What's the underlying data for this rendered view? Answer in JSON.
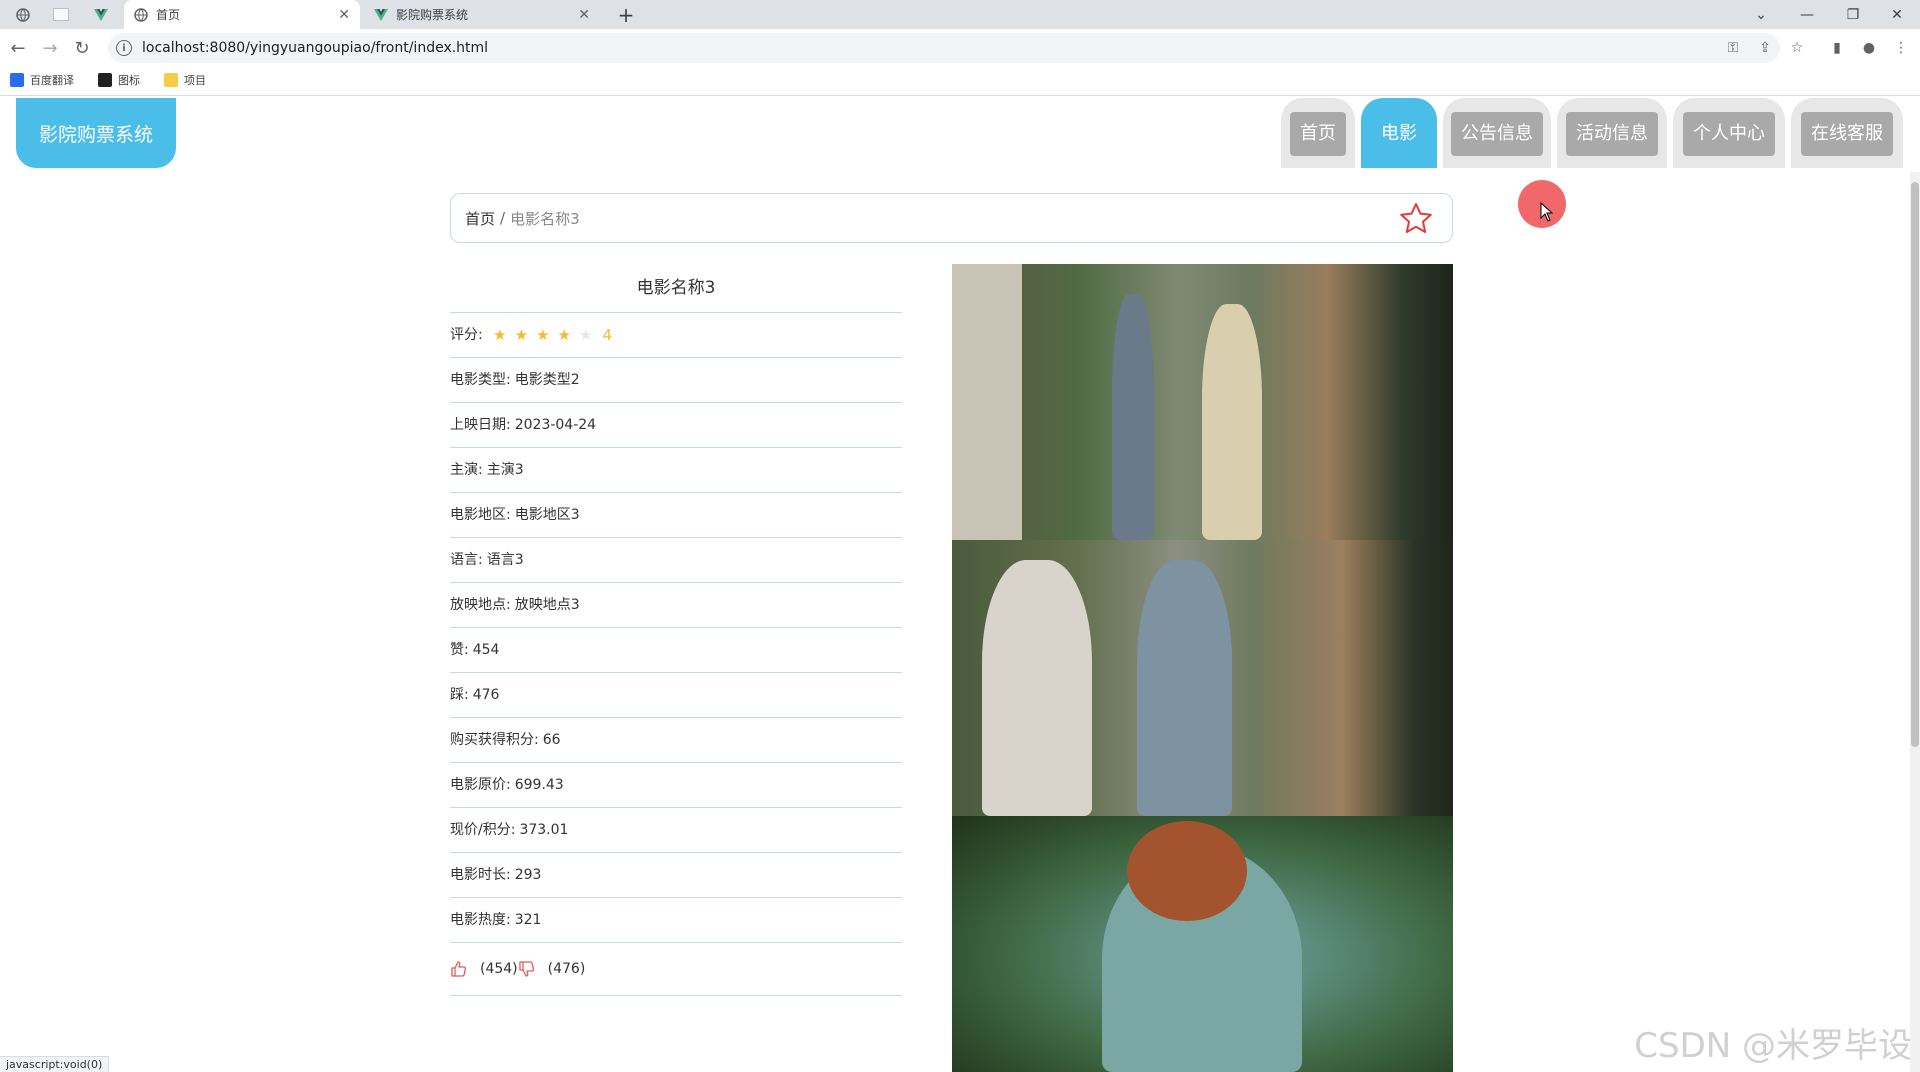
{
  "browser": {
    "tabs": [
      {
        "title": "首页",
        "active": true
      },
      {
        "title": "影院购票系统",
        "active": false
      }
    ],
    "url": "localhost:8080/yingyuangoupiao/front/index.html",
    "bookmarks": [
      "百度翻译",
      "图标",
      "项目"
    ],
    "status_text": "javascript:void(0)"
  },
  "header": {
    "logo": "影院购票系统",
    "nav": [
      {
        "label": "首页",
        "active": false
      },
      {
        "label": "电影",
        "active": true
      },
      {
        "label": "公告信息",
        "active": false
      },
      {
        "label": "活动信息",
        "active": false
      },
      {
        "label": "个人中心",
        "active": false
      },
      {
        "label": "在线客服",
        "active": false
      }
    ]
  },
  "breadcrumb": {
    "home": "首页",
    "separator": "/",
    "current": "电影名称3"
  },
  "movie": {
    "title": "电影名称3",
    "rating_label": "评分:",
    "rating": 4,
    "rating_max": 5,
    "rating_text": "4",
    "fields": [
      {
        "label": "电影类型:",
        "value": "电影类型2"
      },
      {
        "label": "上映日期:",
        "value": "2023-04-24"
      },
      {
        "label": "主演:",
        "value": "主演3"
      },
      {
        "label": "电影地区:",
        "value": "电影地区3"
      },
      {
        "label": "语言:",
        "value": "语言3"
      },
      {
        "label": "放映地点:",
        "value": "放映地点3"
      },
      {
        "label": "赞:",
        "value": "454"
      },
      {
        "label": "踩:",
        "value": "476"
      },
      {
        "label": "购买获得积分:",
        "value": "66"
      },
      {
        "label": "电影原价:",
        "value": "699.43"
      },
      {
        "label": "现价/积分:",
        "value": "373.01"
      },
      {
        "label": "电影时长:",
        "value": "293"
      },
      {
        "label": "电影热度:",
        "value": "321"
      }
    ],
    "thumbs_up": "(454)",
    "thumbs_down": "(476)"
  },
  "watermark": "CSDN @米罗毕设",
  "colors": {
    "accent": "#4bbde9",
    "nav_inactive": "#a9a9a9",
    "star": "#f7ba2a",
    "fav_star": "#e23b3b"
  }
}
